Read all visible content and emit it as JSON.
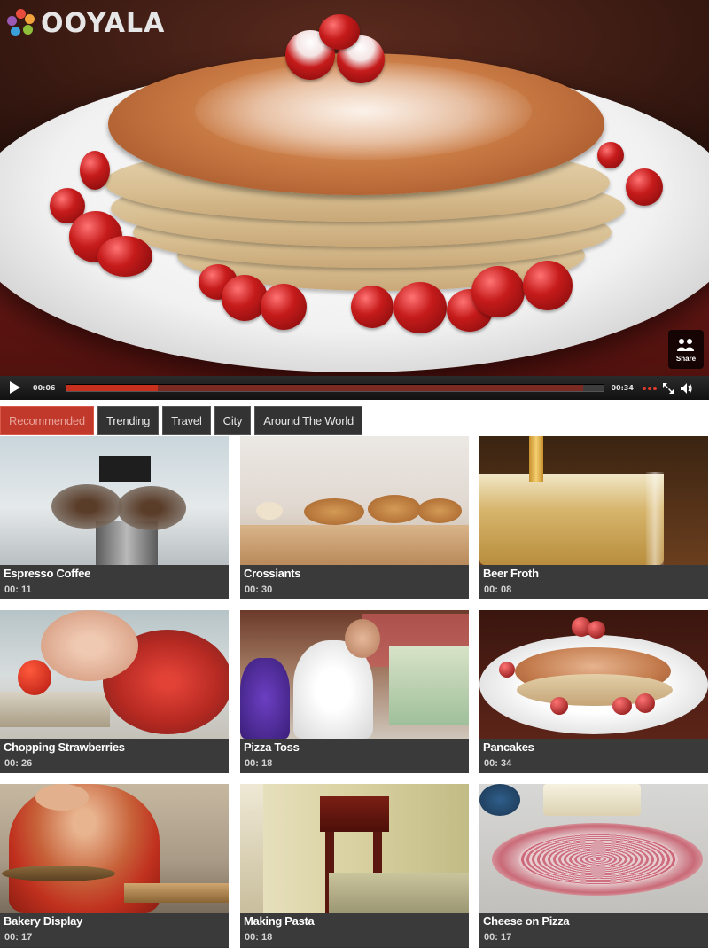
{
  "brand": {
    "logo_text": "OOYALA",
    "logo_colors": [
      "#e84c3d",
      "#f3a33c",
      "#8fbf3b",
      "#3b9fd9",
      "#9b59b6"
    ]
  },
  "player": {
    "current_time": "00:06",
    "duration": "00:34",
    "played_fraction": 0.17,
    "buffered_fraction": 0.96,
    "share_label": "Share",
    "accent_color": "#c8301e"
  },
  "tabs": [
    {
      "label": "Recommended",
      "active": true
    },
    {
      "label": "Trending",
      "active": false
    },
    {
      "label": "Travel",
      "active": false
    },
    {
      "label": "City",
      "active": false
    },
    {
      "label": "Around The World",
      "active": false
    }
  ],
  "videos": [
    {
      "title": "Espresso Coffee",
      "duration": "00: 11"
    },
    {
      "title": "Crossiants",
      "duration": "00: 30"
    },
    {
      "title": "Beer Froth",
      "duration": "00: 08"
    },
    {
      "title": "Chopping Strawberries",
      "duration": "00: 26"
    },
    {
      "title": "Pizza Toss",
      "duration": "00: 18"
    },
    {
      "title": "Pancakes",
      "duration": "00: 34"
    },
    {
      "title": "Bakery Display",
      "duration": "00: 17"
    },
    {
      "title": "Making Pasta",
      "duration": "00: 18"
    },
    {
      "title": "Cheese on Pizza",
      "duration": "00: 17"
    }
  ]
}
